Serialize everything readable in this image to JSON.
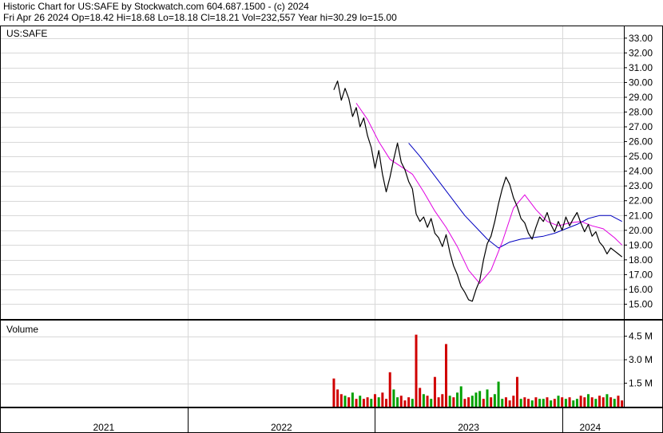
{
  "header": {
    "title": "Historic Chart for US:SAFE by Stockwatch.com 604.687.1500 - (c) 2024",
    "stats": "Fri Apr 26 2024   Op=18.42   Hi=18.68   Lo=18.18   Cl=18.21   Vol=232,557   Year hi=30.29   lo=15.00"
  },
  "chart_data": {
    "type": "line",
    "symbol": "US:SAFE",
    "price_axis": {
      "range": [
        14.0,
        33.8
      ],
      "tick_labels": [
        "33.00",
        "32.00",
        "31.00",
        "30.00",
        "29.00",
        "28.00",
        "27.00",
        "26.00",
        "25.00",
        "24.00",
        "23.00",
        "22.00",
        "21.00",
        "20.00",
        "19.00",
        "18.00",
        "17.00",
        "16.00",
        "15.00"
      ],
      "ticks": [
        33,
        32,
        31,
        30,
        29,
        28,
        27,
        26,
        25,
        24,
        23,
        22,
        21,
        20,
        19,
        18,
        17,
        16,
        15
      ]
    },
    "volume_axis": {
      "label": "Volume",
      "range": [
        0,
        5.5
      ],
      "unit": "M",
      "tick_labels": [
        "4.5 M",
        "3.0 M",
        "1.5 M"
      ],
      "ticks": [
        4.5,
        3.0,
        1.5
      ]
    },
    "x_axis": {
      "range": [
        2021.0,
        2024.33
      ],
      "year_labels": [
        "2021",
        "2022",
        "2023",
        "2024"
      ],
      "year_label_positions": [
        2021.55,
        2022.5,
        2023.5,
        2024.15
      ],
      "year_boundaries": [
        2021.0,
        2022.0,
        2023.0,
        2024.0
      ]
    },
    "price_series": {
      "name": "Price",
      "color": "#000000",
      "x": [
        2022.78,
        2022.8,
        2022.82,
        2022.84,
        2022.86,
        2022.88,
        2022.9,
        2022.92,
        2022.94,
        2022.96,
        2022.98,
        2023.0,
        2023.02,
        2023.04,
        2023.06,
        2023.08,
        2023.1,
        2023.12,
        2023.14,
        2023.16,
        2023.18,
        2023.2,
        2023.22,
        2023.24,
        2023.26,
        2023.28,
        2023.3,
        2023.32,
        2023.34,
        2023.36,
        2023.38,
        2023.4,
        2023.42,
        2023.44,
        2023.46,
        2023.48,
        2023.5,
        2023.52,
        2023.54,
        2023.56,
        2023.58,
        2023.6,
        2023.62,
        2023.64,
        2023.66,
        2023.68,
        2023.7,
        2023.72,
        2023.74,
        2023.76,
        2023.78,
        2023.8,
        2023.82,
        2023.84,
        2023.86,
        2023.88,
        2023.9,
        2023.92,
        2023.94,
        2023.96,
        2023.98,
        2024.0,
        2024.02,
        2024.04,
        2024.06,
        2024.08,
        2024.1,
        2024.12,
        2024.14,
        2024.16,
        2024.18,
        2024.2,
        2024.22,
        2024.24,
        2024.26,
        2024.28,
        2024.3,
        2024.32
      ],
      "y": [
        29.5,
        30.1,
        28.8,
        29.6,
        28.9,
        27.7,
        28.3,
        27.0,
        27.6,
        26.4,
        25.6,
        24.2,
        25.4,
        23.8,
        22.6,
        23.6,
        24.8,
        25.9,
        24.6,
        24.1,
        23.3,
        22.8,
        21.1,
        20.6,
        20.9,
        20.2,
        20.8,
        19.8,
        19.5,
        18.9,
        19.7,
        18.5,
        17.6,
        17.0,
        16.2,
        15.8,
        15.3,
        15.2,
        16.0,
        16.6,
        18.0,
        19.1,
        19.6,
        20.6,
        21.8,
        22.8,
        23.6,
        23.1,
        22.2,
        21.6,
        20.8,
        20.5,
        19.8,
        19.4,
        20.2,
        20.9,
        20.6,
        21.2,
        20.4,
        19.9,
        20.6,
        20.0,
        20.9,
        20.3,
        20.8,
        21.2,
        20.5,
        19.9,
        20.4,
        19.6,
        19.9,
        19.2,
        18.9,
        18.4,
        18.8,
        18.6,
        18.4,
        18.2
      ]
    },
    "ma_short": {
      "name": "",
      "color": "#e000e0",
      "x": [
        2022.9,
        2022.96,
        2023.02,
        2023.08,
        2023.14,
        2023.2,
        2023.26,
        2023.32,
        2023.38,
        2023.44,
        2023.5,
        2023.56,
        2023.62,
        2023.68,
        2023.74,
        2023.8,
        2023.86,
        2023.92,
        2023.98,
        2024.04,
        2024.1,
        2024.16,
        2024.22,
        2024.28,
        2024.32
      ],
      "y": [
        28.6,
        27.5,
        26.0,
        24.8,
        24.3,
        23.8,
        22.6,
        21.3,
        20.2,
        18.9,
        17.3,
        16.4,
        17.3,
        19.2,
        21.5,
        22.4,
        21.4,
        20.6,
        20.3,
        20.5,
        20.6,
        20.3,
        20.1,
        19.5,
        19.0
      ]
    },
    "ma_long": {
      "name": "",
      "color": "#0000c0",
      "x": [
        2023.18,
        2023.24,
        2023.3,
        2023.36,
        2023.42,
        2023.48,
        2023.54,
        2023.6,
        2023.66,
        2023.72,
        2023.78,
        2023.84,
        2023.9,
        2023.96,
        2024.02,
        2024.08,
        2024.14,
        2024.2,
        2024.26,
        2024.32
      ],
      "y": [
        25.9,
        25.0,
        24.0,
        23.0,
        22.0,
        21.0,
        20.2,
        19.4,
        18.8,
        19.2,
        19.4,
        19.5,
        19.6,
        19.8,
        20.1,
        20.4,
        20.8,
        21.0,
        21.0,
        20.6
      ]
    },
    "volume": {
      "name": "Volume",
      "up_color": "#00a000",
      "down_color": "#d00000",
      "x": [
        2022.78,
        2022.8,
        2022.82,
        2022.84,
        2022.86,
        2022.88,
        2022.9,
        2022.92,
        2022.94,
        2022.96,
        2022.98,
        2023.0,
        2023.02,
        2023.04,
        2023.06,
        2023.08,
        2023.1,
        2023.12,
        2023.14,
        2023.16,
        2023.18,
        2023.2,
        2023.22,
        2023.24,
        2023.26,
        2023.28,
        2023.3,
        2023.32,
        2023.34,
        2023.36,
        2023.38,
        2023.4,
        2023.42,
        2023.44,
        2023.46,
        2023.48,
        2023.5,
        2023.52,
        2023.54,
        2023.56,
        2023.58,
        2023.6,
        2023.62,
        2023.64,
        2023.66,
        2023.68,
        2023.7,
        2023.72,
        2023.74,
        2023.76,
        2023.78,
        2023.8,
        2023.82,
        2023.84,
        2023.86,
        2023.88,
        2023.9,
        2023.92,
        2023.94,
        2023.96,
        2023.98,
        2024.0,
        2024.02,
        2024.04,
        2024.06,
        2024.08,
        2024.1,
        2024.12,
        2024.14,
        2024.16,
        2024.18,
        2024.2,
        2024.22,
        2024.24,
        2024.26,
        2024.28,
        2024.3,
        2024.32
      ],
      "y": [
        1.8,
        1.1,
        0.8,
        0.7,
        0.6,
        0.9,
        0.5,
        0.7,
        0.5,
        0.6,
        0.5,
        0.8,
        0.6,
        0.9,
        0.5,
        2.2,
        1.1,
        0.6,
        0.7,
        0.4,
        0.6,
        0.5,
        4.6,
        1.2,
        0.8,
        0.7,
        0.5,
        1.9,
        0.6,
        0.8,
        4.0,
        0.7,
        0.6,
        0.9,
        1.3,
        0.5,
        0.6,
        0.7,
        0.9,
        1.0,
        0.5,
        1.1,
        0.6,
        0.8,
        1.6,
        0.5,
        0.6,
        0.4,
        0.7,
        1.9,
        0.5,
        0.6,
        0.5,
        0.4,
        0.6,
        0.5,
        0.5,
        0.6,
        0.4,
        0.5,
        0.7,
        0.6,
        0.5,
        0.6,
        0.4,
        0.5,
        0.7,
        0.6,
        0.8,
        0.6,
        0.5,
        0.7,
        0.6,
        0.8,
        0.6,
        0.5,
        0.7,
        0.4
      ],
      "up": [
        false,
        false,
        false,
        true,
        false,
        true,
        false,
        true,
        false,
        false,
        true,
        false,
        true,
        false,
        false,
        false,
        true,
        true,
        false,
        false,
        false,
        true,
        false,
        false,
        true,
        false,
        true,
        false,
        false,
        false,
        false,
        true,
        false,
        true,
        true,
        false,
        false,
        true,
        true,
        true,
        false,
        true,
        false,
        true,
        true,
        true,
        false,
        false,
        false,
        false,
        true,
        false,
        false,
        true,
        false,
        true,
        true,
        false,
        true,
        false,
        true,
        false,
        true,
        false,
        true,
        true,
        false,
        false,
        true,
        false,
        true,
        false,
        false,
        true,
        false,
        true,
        false,
        false
      ]
    }
  }
}
